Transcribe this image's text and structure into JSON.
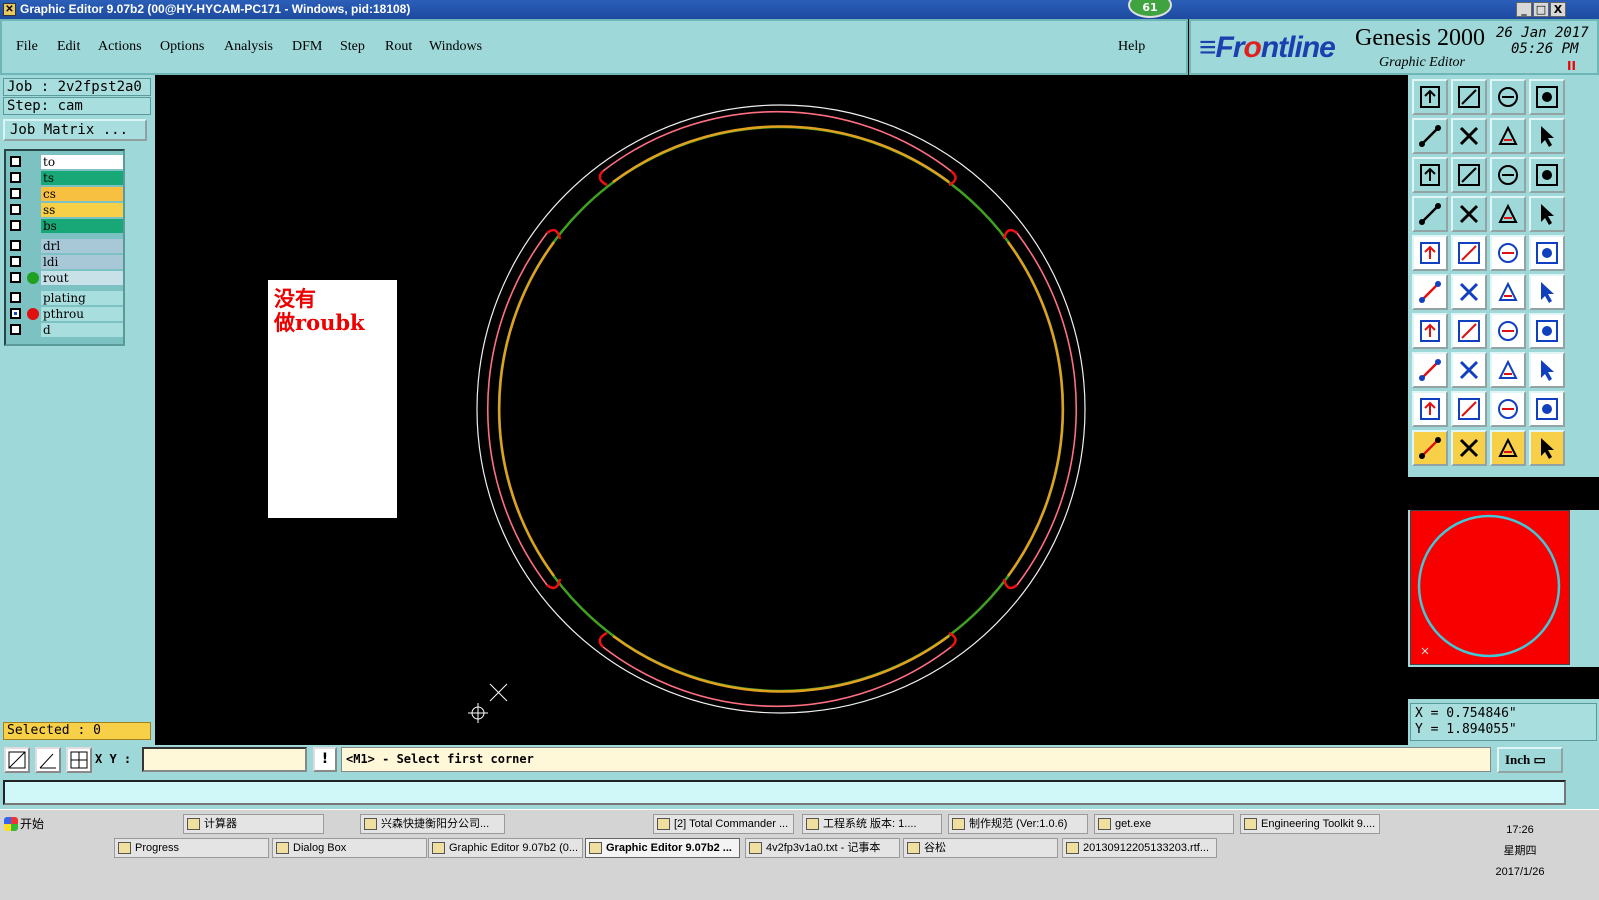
{
  "window": {
    "title": "Graphic Editor 9.07b2 (00@HY-HYCAM-PC171 - Windows, pid:18108)",
    "badge": "61",
    "min": "_",
    "max": "□",
    "close": "X"
  },
  "menu": [
    "File",
    "Edit",
    "Actions",
    "Options",
    "Analysis",
    "DFM",
    "Step",
    "Rout",
    "Windows"
  ],
  "menu_help": "Help",
  "brand": {
    "logo_pre": "≡Fr",
    "logo_o": "o",
    "logo_post": "ntline",
    "product": "Genesis 2000",
    "subtitle": "Graphic Editor",
    "date": "26 Jan 2017",
    "time": "05:26 PM",
    "pause": "II"
  },
  "left": {
    "job": "Job : 2v2fpst2a0",
    "step": "Step: cam",
    "job_matrix": "Job Matrix ...",
    "selected": "Selected : 0",
    "layers": [
      {
        "name": "to",
        "color": "#ffffff",
        "checked": false,
        "dot": ""
      },
      {
        "name": "ts",
        "color": "#18a878",
        "checked": false,
        "dot": ""
      },
      {
        "name": "cs",
        "color": "#f8c040",
        "checked": false,
        "dot": ""
      },
      {
        "name": "ss",
        "color": "#f8d048",
        "checked": false,
        "dot": ""
      },
      {
        "name": "bs",
        "color": "#18a878",
        "checked": false,
        "dot": ""
      },
      {
        "name": "drl",
        "color": "#a8c8d8",
        "checked": false,
        "dot": ""
      },
      {
        "name": "ldi",
        "color": "#a8c8d8",
        "checked": false,
        "dot": ""
      },
      {
        "name": "rout",
        "color": "#c8e0e8",
        "checked": false,
        "dot": "#20a020"
      },
      {
        "name": "plating",
        "color": "#a9dede",
        "checked": false,
        "dot": ""
      },
      {
        "name": "pthrou",
        "color": "#a9dede",
        "checked": true,
        "dot": "#e01010"
      },
      {
        "name": "d",
        "color": "#a9dede",
        "checked": false,
        "dot": ""
      }
    ]
  },
  "note": {
    "line1": "没有",
    "line2": "做roubk"
  },
  "coords": {
    "x": "X = 0.754846\"",
    "y": "Y = 1.894055\""
  },
  "cmd": {
    "xy_label": "X Y :",
    "xy_value": "",
    "excl": "!",
    "prompt": "<M1> - Select first corner",
    "unit": "Inch"
  },
  "taskbar": {
    "start": "开始",
    "row1": [
      "计算器",
      "兴森快捷衡阳分公司...",
      "[2] Total Commander ...",
      "工程系统  版本: 1....",
      "制作规范 (Ver:1.0.6)",
      "get.exe",
      "Engineering Toolkit 9...."
    ],
    "row2": [
      "Progress",
      "Dialog Box",
      "Graphic Editor 9.07b2 (0...",
      "Graphic Editor 9.07b2 ...",
      "4v2fp3v1a0.txt - 记事本",
      "谷松",
      "20130912205133203.rtf..."
    ],
    "clock_time": "17:26",
    "clock_day": "星期四",
    "clock_date": "2017/1/26"
  },
  "colors": {
    "panel": "#9ed8d8",
    "canvas": "#000000",
    "outline": "#ff6f7f",
    "rout_orange": "#e09a1a",
    "rout_green": "#40a020",
    "preview_bg": "#f80000",
    "preview_circle": "#40c8d8"
  },
  "tool_icons": [
    "zoom-home-icon",
    "zoom-in-icon",
    "home-icon",
    "split-view-icon",
    "pan-left-icon",
    "pan-right-icon",
    "zoom-back-icon",
    "snap-icon",
    "fit-vertical-icon",
    "fit-all-icon",
    "scale-1-2-icon",
    "help-icon",
    "measure-icon",
    "grid-icon",
    "layer-red-icon",
    "layer-black-icon",
    "pad-icon",
    "line-icon",
    "ruler-icon",
    "circle-pad-icon",
    "net-icon",
    "cross-icon",
    "connect-icon",
    "connect-arrow-icon",
    "angle-icon",
    "slope-icon",
    "arc-icon",
    "mirror-icon",
    "move-icon",
    "dash-icon",
    "dimension-icon",
    "copy-icon",
    "triangle-icon",
    "apex-icon",
    "apex-up-icon",
    "apex-box-icon",
    "pointer-icon",
    "select-box-icon",
    "select-rotate-icon",
    "select-path-icon"
  ]
}
